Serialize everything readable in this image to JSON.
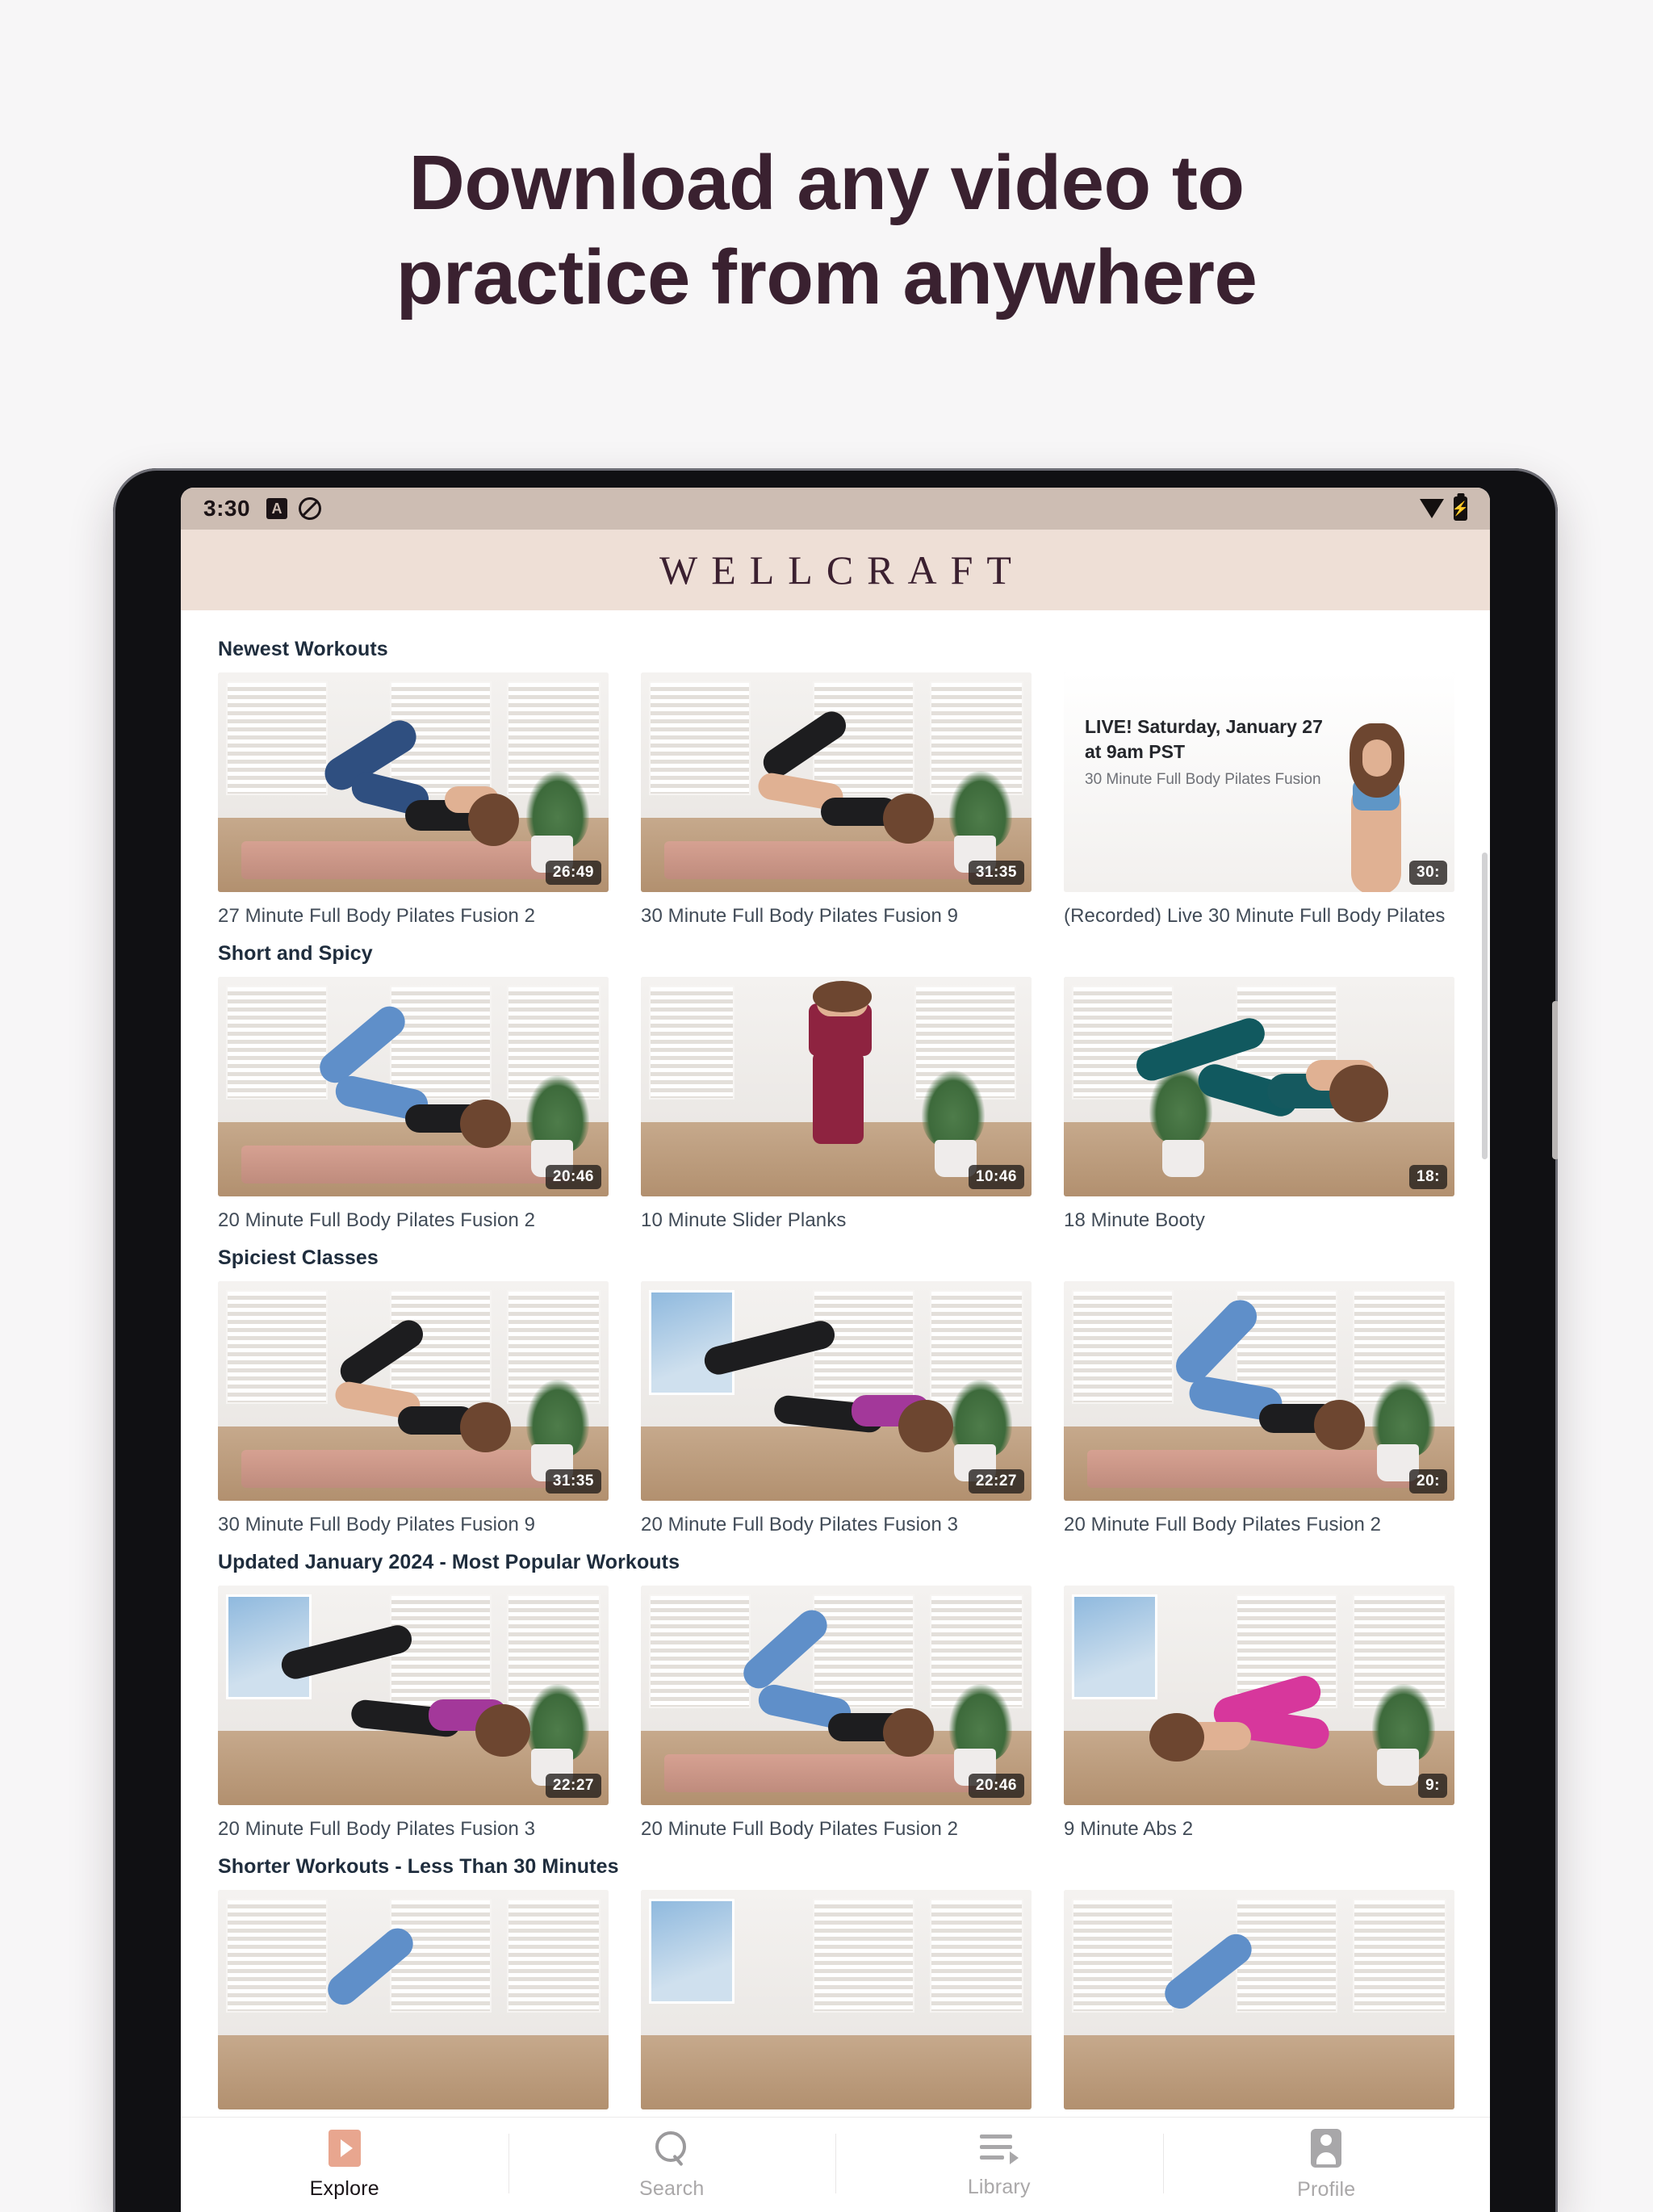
{
  "promo": {
    "headline_line1": "Download any video to",
    "headline_line2": "practice from anywhere",
    "headline_color": "#3a2130",
    "background_color": "#f7f6f7"
  },
  "status_bar": {
    "time": "3:30",
    "badge_a": "A",
    "icons": [
      "do-not-disturb-icon",
      "wifi-icon",
      "battery-charging-icon"
    ],
    "background_color": "#cdbdb3"
  },
  "app_header": {
    "brand": "WELLCRAFT",
    "background_color": "#eedfd6",
    "text_color": "#3b2030"
  },
  "sections": [
    {
      "title": "Newest Workouts",
      "cards": [
        {
          "title": "27 Minute Full Body Pilates Fusion 2",
          "duration": "26:49",
          "scene": "a"
        },
        {
          "title": "30 Minute Full Body Pilates Fusion 9",
          "duration": "31:35",
          "scene": "b"
        },
        {
          "title": "(Recorded) Live 30 Minute Full Body Pilates",
          "duration": "30:",
          "scene": "live",
          "live_line1": "LIVE! Saturday, January 27",
          "live_line2": "at 9am PST",
          "live_sub": "30 Minute Full Body Pilates Fusion"
        }
      ]
    },
    {
      "title": "Short and Spicy",
      "cards": [
        {
          "title": "20 Minute Full Body Pilates Fusion 2",
          "duration": "20:46",
          "scene": "c"
        },
        {
          "title": "10 Minute Slider Planks",
          "duration": "10:46",
          "scene": "d"
        },
        {
          "title": "18 Minute Booty",
          "duration": "18:",
          "scene": "e"
        }
      ]
    },
    {
      "title": "Spiciest Classes",
      "cards": [
        {
          "title": "30 Minute Full Body Pilates Fusion 9",
          "duration": "31:35",
          "scene": "b"
        },
        {
          "title": "20 Minute Full Body Pilates Fusion 3",
          "duration": "22:27",
          "scene": "f"
        },
        {
          "title": "20 Minute Full Body Pilates Fusion 2",
          "duration": "20:",
          "scene": "g"
        }
      ]
    },
    {
      "title": "Updated January 2024 - Most Popular Workouts",
      "cards": [
        {
          "title": "20 Minute Full Body Pilates Fusion 3",
          "duration": "22:27",
          "scene": "f"
        },
        {
          "title": "20 Minute Full Body Pilates Fusion 2",
          "duration": "20:46",
          "scene": "c"
        },
        {
          "title": "9 Minute Abs 2",
          "duration": "9:",
          "scene": "h"
        }
      ]
    },
    {
      "title": "Shorter Workouts - Less Than 30 Minutes",
      "cards": [
        {
          "title": "",
          "duration": "",
          "scene": "a"
        },
        {
          "title": "",
          "duration": "",
          "scene": "f"
        },
        {
          "title": "",
          "duration": "",
          "scene": "c"
        }
      ]
    }
  ],
  "bottom_nav": {
    "active": "Explore",
    "items": [
      {
        "label": "Explore",
        "icon": "play-button-icon"
      },
      {
        "label": "Search",
        "icon": "search-icon"
      },
      {
        "label": "Library",
        "icon": "playlist-icon"
      },
      {
        "label": "Profile",
        "icon": "person-icon"
      }
    ],
    "active_accent_color": "#e8a68f"
  }
}
